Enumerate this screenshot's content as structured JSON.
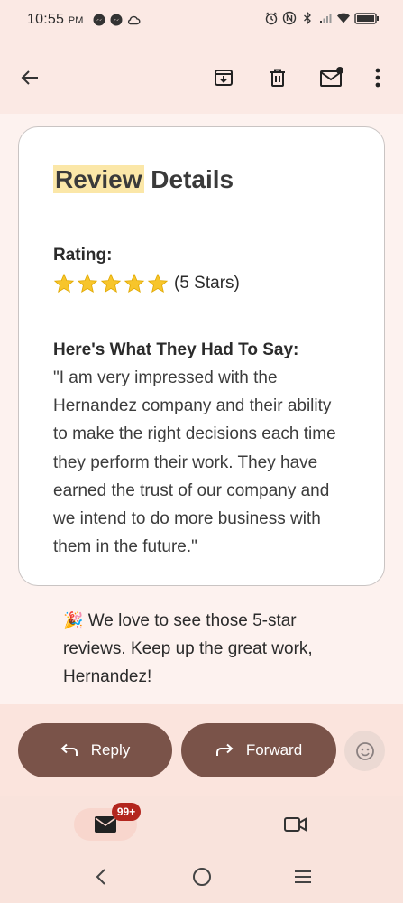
{
  "status_bar": {
    "time": "10:55",
    "ampm": "PM",
    "left_icons": [
      "messenger-icon",
      "messenger-icon",
      "cloud-icon"
    ],
    "right_icons": [
      "alarm-icon",
      "nfc-icon",
      "bluetooth-icon",
      "signal-icon",
      "wifi-icon",
      "battery-icon"
    ]
  },
  "toolbar": {
    "back_icon": "arrow-left-icon",
    "archive_icon": "archive-icon",
    "delete_icon": "trash-icon",
    "unread_icon": "mark-unread-icon",
    "more_icon": "more-vert-icon"
  },
  "card": {
    "title_highlight": "Review",
    "title_rest": " Details",
    "rating_label": "Rating:",
    "star_count": 5,
    "rating_text": "(5 Stars)",
    "say_label": "Here's What They Had To Say:",
    "review_text": "\"I am very impressed with the Hernandez company and their ability to make the right decisions each time they perform their work. They have earned the trust of our company and we intend to do more business with them in the future.\""
  },
  "note": {
    "emoji": "🎉",
    "text": " We love to see those 5-star reviews. Keep up the great work, Hernandez!"
  },
  "actions": {
    "reply_label": "Reply",
    "forward_label": "Forward",
    "emoji_icon": "emoji-reaction-icon"
  },
  "bottom_nav": {
    "mail_badge": "99+",
    "mail_icon": "mail-icon",
    "meet_icon": "video-icon"
  },
  "colors": {
    "accent": "#7a5349",
    "background": "#f9e3dc",
    "highlight": "#fbe7a8",
    "badge": "#b3261e"
  }
}
